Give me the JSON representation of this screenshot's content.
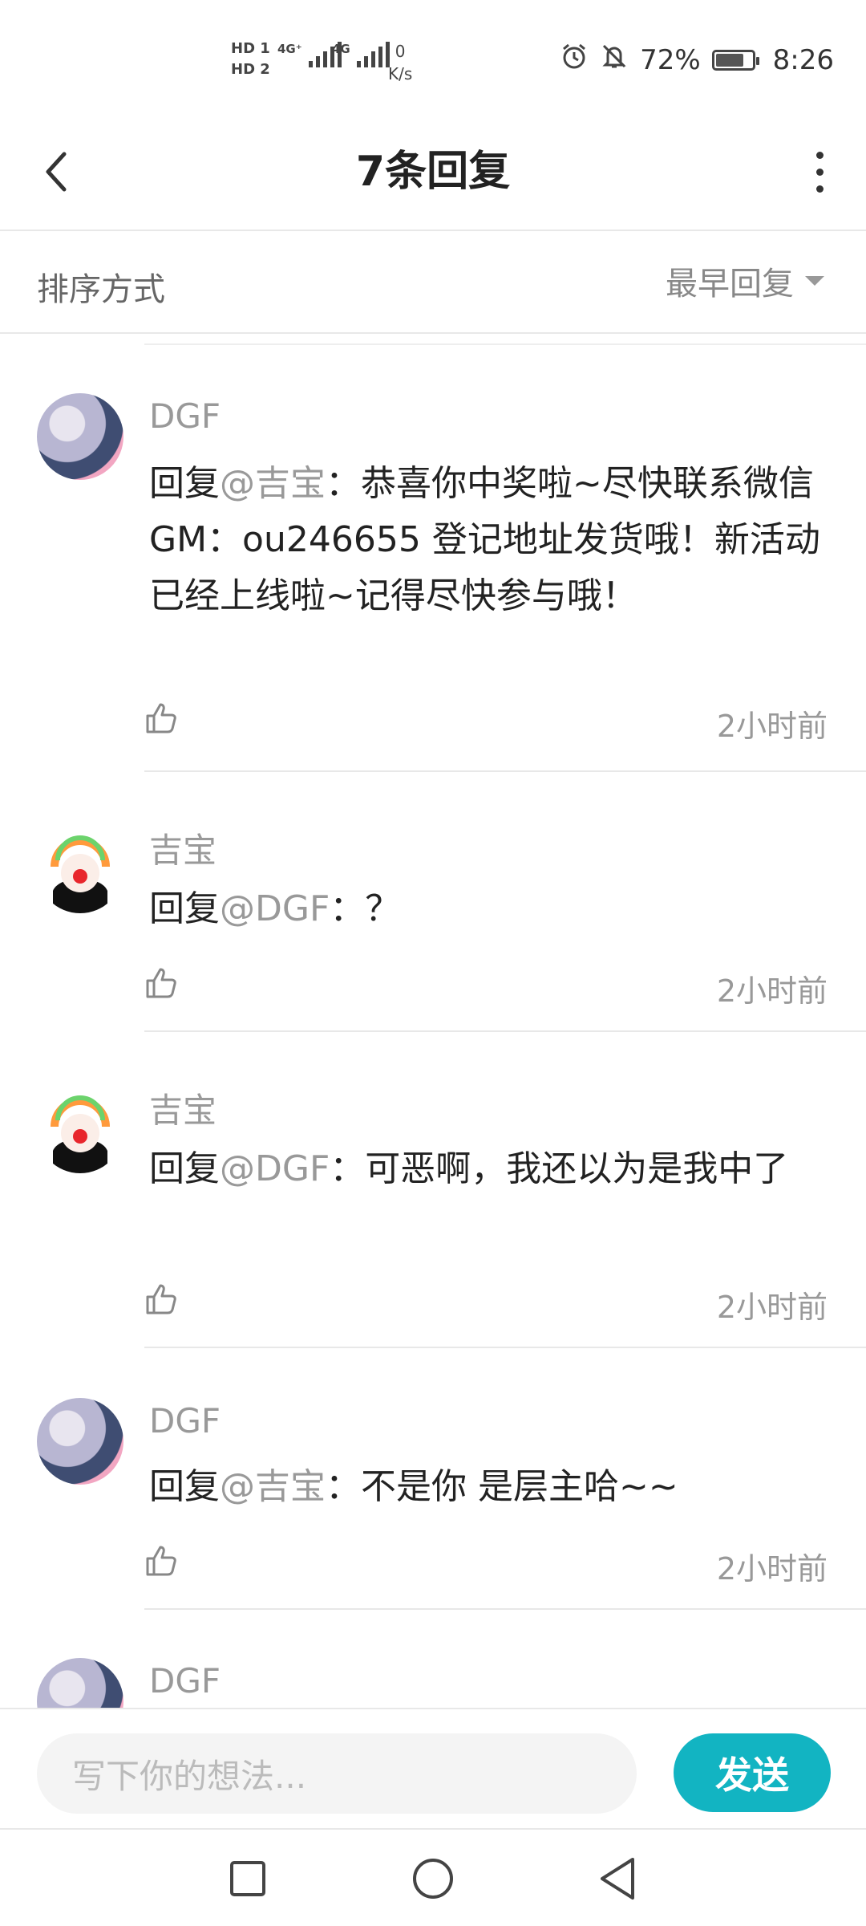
{
  "status_bar": {
    "hd1": "HD 1",
    "hd2": "HD 2",
    "net1": "4G⁺",
    "net2": "4G",
    "speed_value": "0",
    "speed_unit": "K/s",
    "battery": "72%",
    "time": "8:26"
  },
  "header": {
    "title": "7条回复"
  },
  "sort": {
    "label": "排序方式",
    "selected": "最早回复"
  },
  "replies": [
    {
      "user": "DGF",
      "prefix": "回复",
      "mention": "@吉宝",
      "text": "：恭喜你中奖啦~尽快联系微信GM：ou246655 登记地址发货哦！新活动已经上线啦~记得尽快参与哦！",
      "time": "2小时前"
    },
    {
      "user": "吉宝",
      "prefix": "回复",
      "mention": "@DGF",
      "text": "：？",
      "time": "2小时前"
    },
    {
      "user": "吉宝",
      "prefix": "回复",
      "mention": "@DGF",
      "text": "：可恶啊，我还以为是我中了",
      "time": "2小时前"
    },
    {
      "user": "DGF",
      "prefix": "回复",
      "mention": "@吉宝",
      "text": "：不是你 是层主哈~~",
      "time": "2小时前"
    },
    {
      "user": "DGF"
    }
  ],
  "input": {
    "placeholder": "写下你的想法...",
    "send_label": "发送"
  },
  "colors": {
    "accent": "#12b4c2",
    "muted_text": "#999999",
    "body_text": "#222222"
  }
}
